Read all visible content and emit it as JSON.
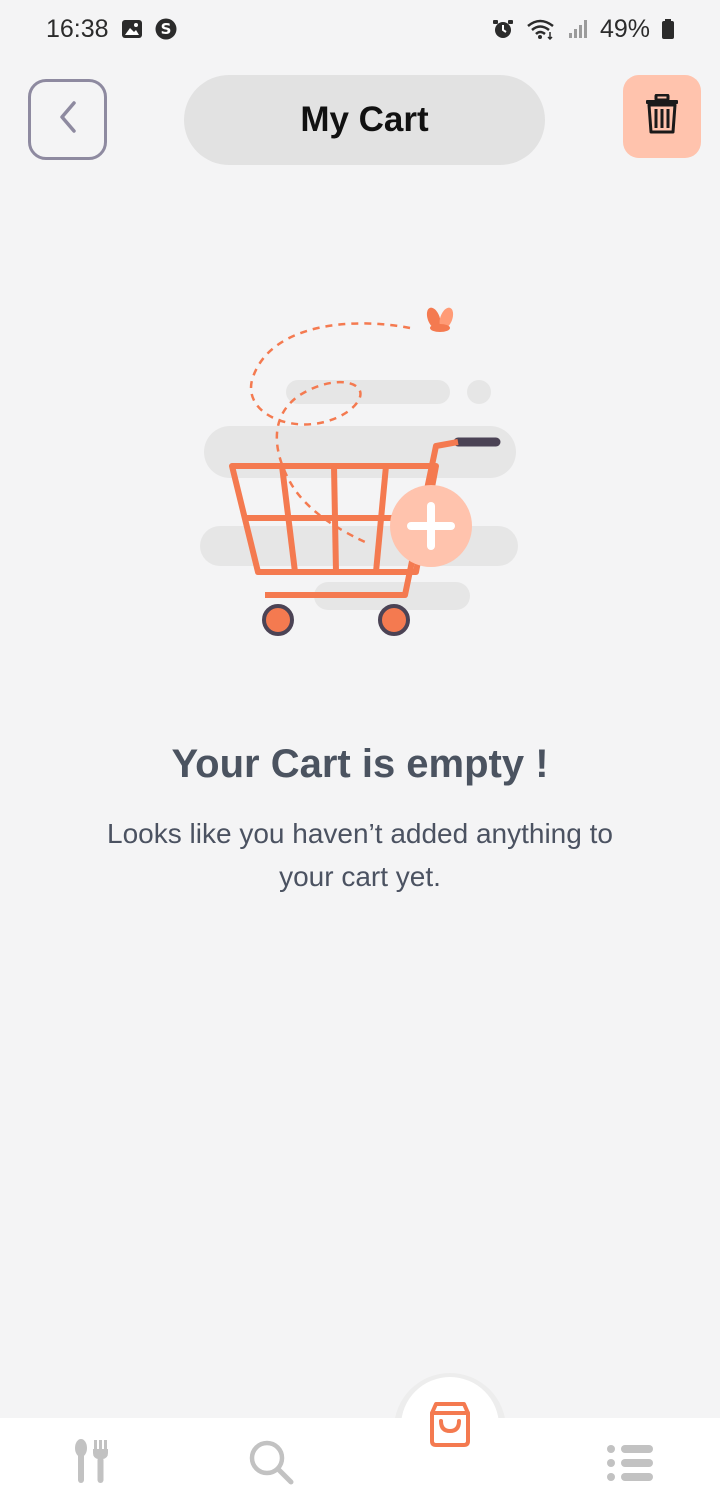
{
  "status_bar": {
    "time": "16:38",
    "battery": "49%",
    "icons_left": [
      "gallery-icon",
      "s-circle-icon"
    ],
    "icons_right": [
      "alarm-icon",
      "wifi-icon",
      "signal-icon",
      "battery-icon"
    ]
  },
  "header": {
    "title": "My Cart",
    "back_icon": "chevron-left-icon",
    "delete_icon": "trash-icon"
  },
  "empty_state": {
    "title": "Your Cart is empty !",
    "subtitle": "Looks like you haven’t added anything to your cart yet."
  },
  "bottom_nav": {
    "items": [
      {
        "icon": "fork-spoon-icon"
      },
      {
        "icon": "search-icon"
      },
      {
        "icon": "shopping-bag-icon",
        "active": true
      },
      {
        "icon": "list-icon"
      }
    ]
  },
  "colors": {
    "accent": "#f47a50",
    "accent_light": "#ffc3ad",
    "background": "#f4f4f5",
    "text": "#4b5261"
  }
}
